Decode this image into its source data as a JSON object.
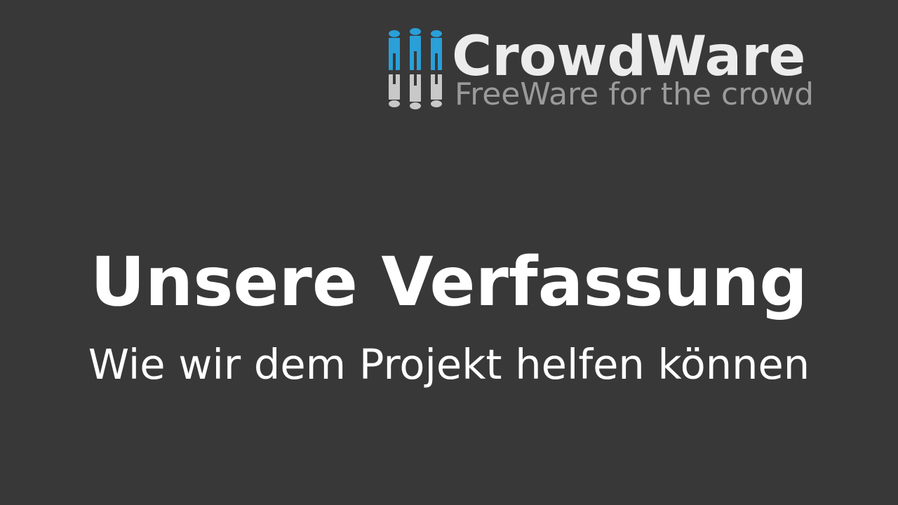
{
  "logo": {
    "name": "CrowdWare",
    "tagline": "FreeWare for the crowd",
    "mark_icon": "crowd-people-icon"
  },
  "slide": {
    "title": "Unsere Verfassung",
    "subtitle": "Wie wir dem Projekt helfen können"
  },
  "colors": {
    "background": "#383838",
    "logo_blue": "#2a9fd8",
    "logo_grey": "#c8c8c8",
    "logo_name": "#ececec",
    "tagline": "#9a9a9a",
    "text": "#ffffff"
  }
}
